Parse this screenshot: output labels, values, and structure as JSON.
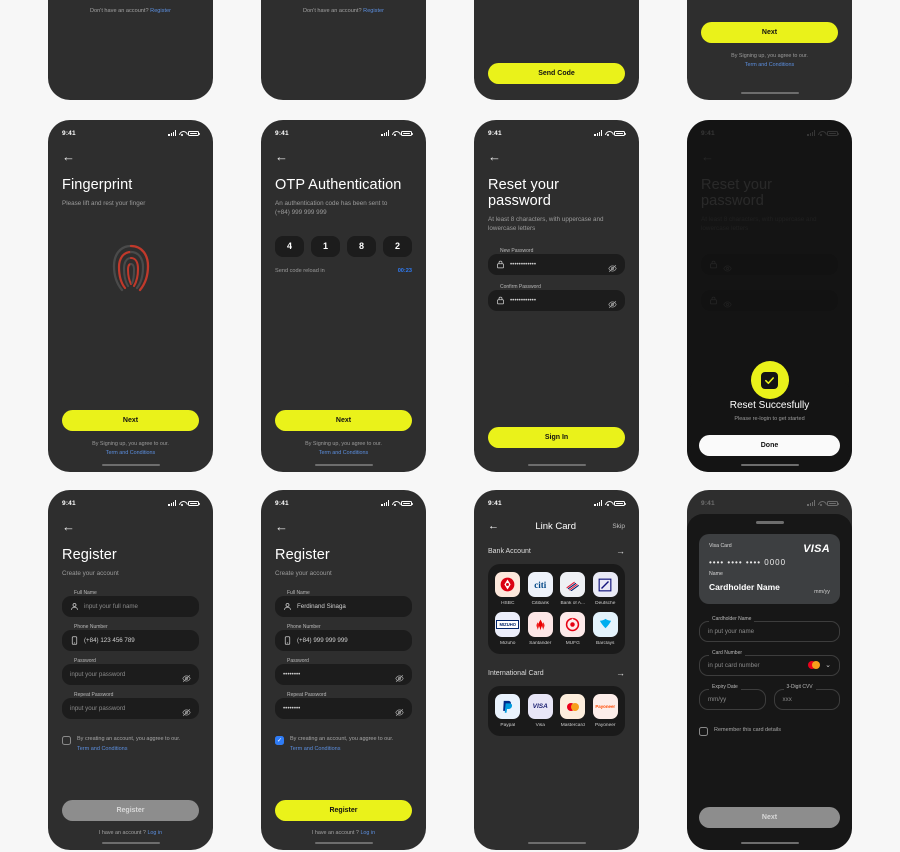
{
  "common": {
    "status_time": "9:41",
    "back_icon": "arrow-left-icon",
    "terms_prefix": "By Signing up, you agree to our.",
    "terms_link": "Term and Conditions",
    "next_label": "Next"
  },
  "screens": {
    "login_partial_a": {
      "footer_text": "Don't have an account?",
      "footer_link": "Register"
    },
    "login_partial_b": {
      "footer_text": "Don't have an account?",
      "footer_link": "Register"
    },
    "send_code_partial": {
      "button_label": "Send Code"
    },
    "next_terms_partial": {
      "button_label": "Next",
      "terms_prefix": "By Signing up, you agree to our.",
      "terms_link": "Term and Conditions"
    },
    "fingerprint": {
      "title": "Fingerprint",
      "subtitle": "Please lift and rest your finger",
      "button_label": "Next",
      "terms_prefix": "By Signing up, you agree to our.",
      "terms_link": "Term and Conditions"
    },
    "otp": {
      "title": "OTP Authentication",
      "subtitle_line1": "An authentication code has been sent to",
      "subtitle_line2": "(+84) 999 999 999",
      "digits": [
        "4",
        "1",
        "8",
        "2"
      ],
      "resend_label": "Send code reload in",
      "timer": "00:23",
      "button_label": "Next",
      "terms_prefix": "By Signing up, you agree to our.",
      "terms_link": "Term and Conditions"
    },
    "reset_password": {
      "title": "Reset your password",
      "subtitle": "At least 8 characters, with uppercase and lowercase letters",
      "new_password_label": "New Password",
      "new_password_value": "••••••••••••",
      "confirm_password_label": "Confirm Password",
      "confirm_password_value": "••••••••••••",
      "button_label": "Sign In"
    },
    "reset_success": {
      "title": "Reset Succesfully",
      "subtitle": "Please re-login to get started",
      "button_label": "Done",
      "bg_title": "Reset your password",
      "bg_sub": "At least 8 characters, with uppercase and lowercase letters"
    },
    "register_empty": {
      "title": "Register",
      "subtitle": "Create your account",
      "fields": [
        {
          "label": "Full Name",
          "value": "input your full name",
          "placeholder": true,
          "icon": "person-icon"
        },
        {
          "label": "Phone Number",
          "value": "(+84) 123 456 789",
          "placeholder": false,
          "icon": "phone-icon"
        },
        {
          "label": "Password",
          "value": "input your password",
          "placeholder": true,
          "icon": "none"
        },
        {
          "label": "Repeat Password",
          "value": "input your password",
          "placeholder": true,
          "icon": "none"
        }
      ],
      "consent_text": "By creating an account, you aggree to our.",
      "consent_link": "Term and Conditions",
      "checked": false,
      "button_label": "Register",
      "button_state": "disabled",
      "footer_text": "I have an account ?",
      "footer_link": "Log in"
    },
    "register_filled": {
      "title": "Register",
      "subtitle": "Create your account",
      "fields": [
        {
          "label": "Full Name",
          "value": "Ferdinand Sinaga",
          "placeholder": false,
          "icon": "person-icon"
        },
        {
          "label": "Phone Number",
          "value": "(+84) 999 999 999",
          "placeholder": false,
          "icon": "phone-icon"
        },
        {
          "label": "Password",
          "value": "••••••••",
          "placeholder": false,
          "icon": "none"
        },
        {
          "label": "Repeat Password",
          "value": "••••••••",
          "placeholder": false,
          "icon": "none"
        }
      ],
      "consent_text": "By creating an account, you aggree to our.",
      "consent_link": "Term and Conditions",
      "checked": true,
      "button_label": "Register",
      "button_state": "enabled",
      "footer_text": "I have an account ?",
      "footer_link": "Log in"
    },
    "link_card": {
      "title": "Link Card",
      "skip_label": "Skip",
      "sections": [
        {
          "heading": "Bank Account",
          "items": [
            {
              "name": "HSBC",
              "logo": "hsbc-logo"
            },
            {
              "name": "Citibank",
              "logo": "citi-logo"
            },
            {
              "name": "Bank of A...",
              "logo": "bank-of-america-logo"
            },
            {
              "name": "Deutsche",
              "logo": "deutsche-bank-logo"
            },
            {
              "name": "Mizuho",
              "logo": "mizuho-logo"
            },
            {
              "name": "Santander",
              "logo": "santander-logo"
            },
            {
              "name": "MUFG",
              "logo": "mufg-logo"
            },
            {
              "name": "Barclays",
              "logo": "barclays-logo"
            }
          ]
        },
        {
          "heading": "International Card",
          "items": [
            {
              "name": "Paypal",
              "logo": "paypal-logo"
            },
            {
              "name": "Visa",
              "logo": "visa-logo"
            },
            {
              "name": "Mastercard",
              "logo": "mastercard-logo"
            },
            {
              "name": "Payoneer",
              "logo": "payoneer-logo"
            }
          ]
        }
      ]
    },
    "card_details": {
      "card_preview": {
        "type_label": "Visa Card",
        "brand": "VISA",
        "number": "•••• •••• •••• 0000",
        "name_label": "Name",
        "holder": "Cardholder Name",
        "expiry": "mm/yy"
      },
      "fields": [
        {
          "label": "Cardholder Name",
          "value": "in put your name"
        },
        {
          "label": "Card Number",
          "value": "in put card number"
        },
        {
          "label": "Expiry Date",
          "value": "mm/yy"
        },
        {
          "label": "3-Digit CVV",
          "value": "xxx"
        }
      ],
      "remember_label": "Remember this card details",
      "checked": false,
      "button_label": "Next",
      "button_state": "disabled"
    }
  },
  "colors": {
    "accent_yellow": "#eaf21a",
    "link_blue": "#5b8ede",
    "checkbox_blue": "#2f7cf6",
    "phone_bg": "#2e2e2e",
    "field_bg": "#1c1c1c",
    "page_bg": "#f7f7f7"
  }
}
